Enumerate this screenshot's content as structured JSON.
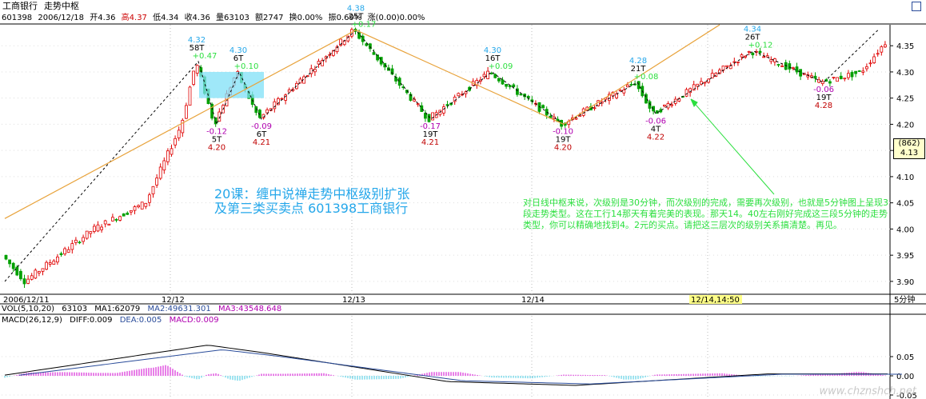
{
  "titlebar": {
    "stock": "工商银行",
    "view": "走势中枢"
  },
  "info": {
    "code": "601398",
    "date": "2006/12/18",
    "open": "开4.36",
    "high": "高4.37",
    "low": "低4.34",
    "close": "收4.36",
    "volume": "量63103",
    "amount": "额2747",
    "turnover": "换0.00%",
    "amplitude": "振0.69%",
    "change": "涨(0.00)0.00%"
  },
  "price_axis": {
    "labels": [
      "4.35",
      "4.30",
      "4.25",
      "4.20",
      "4.15",
      "4.10",
      "4.05",
      "4.00",
      "3.95",
      "3.90"
    ],
    "current_box": "(862)",
    "current": "4.13"
  },
  "x_axis": {
    "labels": [
      "2006/12/11",
      "12/12",
      "12/13",
      "12/14",
      "12/14,14:50",
      "5分钟"
    ]
  },
  "volume_bar": {
    "label": "VOL(5,10,20)",
    "vol": "63103",
    "ma1": "MA1:62079",
    "ma2": "MA2:49631.301",
    "ma3": "MA3:43548.648"
  },
  "macd_bar": {
    "label": "MACD(26,12,9)",
    "diff": "DIFF:0.009",
    "dea": "DEA:0.005",
    "macd": "MACD:0.009"
  },
  "macd_axis": {
    "labels": [
      "0.05",
      "0.00",
      "-0.05"
    ]
  },
  "annotation_title_1": "20课：缠中说禅走势中枢级别扩张",
  "annotation_title_2": "及第三类买卖点   601398工商银行",
  "annotation_body": "对日线中枢来说，次级别是30分钟，而次级别的完成，需要再次级别，也就是5分钟图上呈现3段走势类型。这在工行14那天有着完美的表现。那天14。40左右刚好完成这三段5分钟的走势类型，你可以精确地找到4。2元的买点。请把这三层次的级别关系搞清楚。再见。",
  "watermark": "www.chznshch.net",
  "chart_data": {
    "type": "candlestick",
    "title": "",
    "ylim": [
      3.88,
      4.39
    ],
    "pivots": [
      {
        "label": "58T",
        "price": "4.32",
        "change": "+0.47",
        "dir": "up"
      },
      {
        "label": "5T",
        "price": "4.20",
        "change": "-0.12",
        "dir": "down"
      },
      {
        "label": "6T",
        "price": "4.30",
        "change": "+0.10",
        "dir": "up"
      },
      {
        "label": "6T",
        "price": "4.21",
        "change": "-0.09",
        "dir": "down"
      },
      {
        "label": "25T",
        "price": "4.38",
        "change": "+0.17",
        "dir": "up"
      },
      {
        "label": "19T",
        "price": "4.21",
        "change": "-0.17",
        "dir": "down"
      },
      {
        "label": "16T",
        "price": "4.30",
        "change": "+0.09",
        "dir": "up"
      },
      {
        "label": "19T",
        "price": "4.20",
        "change": "-0.10",
        "dir": "down"
      },
      {
        "label": "21T",
        "price": "4.28",
        "change": "+0.08",
        "dir": "up"
      },
      {
        "label": "4T",
        "price": "4.22",
        "change": "-0.06",
        "dir": "down"
      },
      {
        "label": "26T",
        "price": "4.34",
        "change": "+0.12",
        "dir": "up"
      },
      {
        "label": "19T",
        "price": "4.28",
        "change": "-0.06",
        "dir": "down"
      }
    ]
  }
}
